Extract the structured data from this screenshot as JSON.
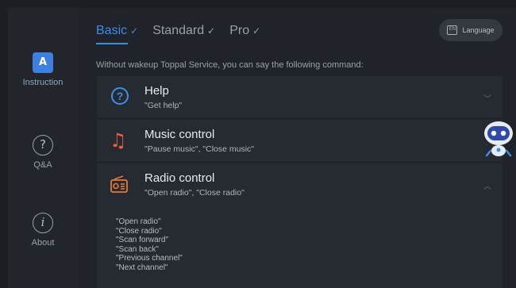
{
  "sidebar": {
    "items": [
      {
        "label": "Instruction",
        "icon": "a-badge-icon",
        "glyph": "A",
        "active": true
      },
      {
        "label": "Q&A",
        "icon": "question-circle-icon",
        "glyph": "?"
      },
      {
        "label": "About",
        "icon": "info-circle-icon",
        "glyph": "i"
      }
    ]
  },
  "tabs": [
    {
      "label": "Basic",
      "check": "✓",
      "active": true
    },
    {
      "label": "Standard",
      "check": "✓"
    },
    {
      "label": "Pro",
      "check": "✓"
    }
  ],
  "language_button": {
    "label": "Language",
    "icon": "keyboard-icon",
    "icon_text": "EN"
  },
  "hint": "Without wakeup Toppal Service, you can say the following command:",
  "commands": [
    {
      "title": "Help",
      "subtitle": "\"Get help\"",
      "icon": "help-circle-icon",
      "glyph": "?",
      "chevron": "﹀"
    },
    {
      "title": "Music control",
      "subtitle": "\"Pause music\", \"Close music\"",
      "icon": "music-note-icon",
      "glyph": "♫"
    },
    {
      "title": "Radio control",
      "subtitle": "\"Open radio\", \"Close radio\"",
      "icon": "radio-icon",
      "chevron": "︿",
      "expanded_items": [
        "\"Open radio\"",
        "\"Close radio\"",
        "\"Scan forward\"",
        "\"Scan back\"",
        "\"Previous channel\"",
        "\"Next channel\""
      ]
    }
  ],
  "colors": {
    "accent": "#3d8ce8",
    "music_icon": "#e8613c",
    "radio_icon": "#e8773c",
    "background": "#20242a",
    "card": "#262a31"
  }
}
